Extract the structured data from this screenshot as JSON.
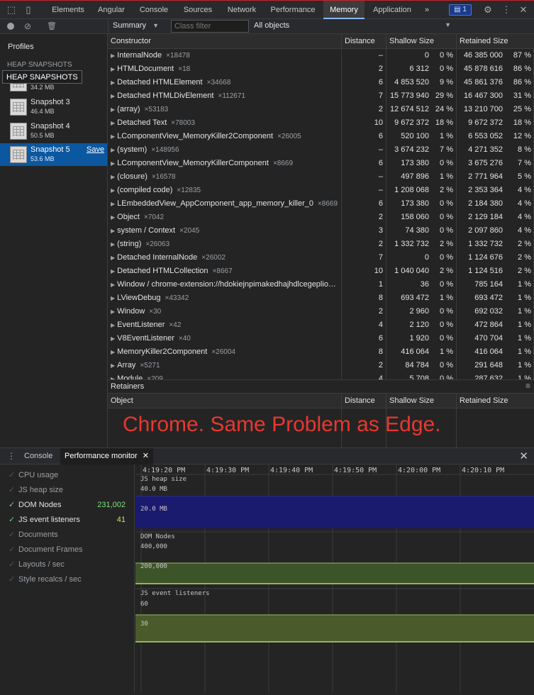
{
  "tabs": [
    "Elements",
    "Angular",
    "Console",
    "Sources",
    "Network",
    "Performance",
    "Memory",
    "Application"
  ],
  "tab_more": "»",
  "issues_badge": "1",
  "toolbar": {
    "summary": "Summary",
    "class_filter_placeholder": "Class filter",
    "objects": "All objects"
  },
  "sidebar": {
    "profiles": "Profiles",
    "heap_snapshots": "HEAP SNAPSHOTS",
    "tooltip": "HEAP SNAPSHOTS",
    "snap2_size": "34.2 MB",
    "snapshots": [
      {
        "name": "Snapshot 3",
        "size": "46.4 MB"
      },
      {
        "name": "Snapshot 4",
        "size": "50.5 MB"
      },
      {
        "name": "Snapshot 5",
        "size": "53.6 MB",
        "action": "Save"
      }
    ]
  },
  "grid": {
    "headers": {
      "constructor": "Constructor",
      "distance": "Distance",
      "shallow": "Shallow Size",
      "retained": "Retained Size"
    },
    "rows": [
      {
        "name": "InternalNode",
        "count": "×18478",
        "dist": "–",
        "shallow": "0",
        "sp": "0 %",
        "retained": "46 385 000",
        "rp": "87 %"
      },
      {
        "name": "HTMLDocument",
        "count": "×18",
        "dist": "2",
        "shallow": "6 312",
        "sp": "0 %",
        "retained": "45 878 616",
        "rp": "86 %"
      },
      {
        "name": "Detached HTMLElement",
        "count": "×34668",
        "dist": "6",
        "shallow": "4 853 520",
        "sp": "9 %",
        "retained": "45 861 376",
        "rp": "86 %"
      },
      {
        "name": "Detached HTMLDivElement",
        "count": "×112671",
        "dist": "7",
        "shallow": "15 773 940",
        "sp": "29 %",
        "retained": "16 467 300",
        "rp": "31 %"
      },
      {
        "name": "(array)",
        "count": "×53183",
        "dist": "2",
        "shallow": "12 674 512",
        "sp": "24 %",
        "retained": "13 210 700",
        "rp": "25 %"
      },
      {
        "name": "Detached Text",
        "count": "×78003",
        "dist": "10",
        "shallow": "9 672 372",
        "sp": "18 %",
        "retained": "9 672 372",
        "rp": "18 %"
      },
      {
        "name": "LComponentView_MemoryKiller2Component",
        "count": "×26005",
        "dist": "6",
        "shallow": "520 100",
        "sp": "1 %",
        "retained": "6 553 052",
        "rp": "12 %"
      },
      {
        "name": "(system)",
        "count": "×148956",
        "dist": "–",
        "shallow": "3 674 232",
        "sp": "7 %",
        "retained": "4 271 352",
        "rp": "8 %"
      },
      {
        "name": "LComponentView_MemoryKillerComponent",
        "count": "×8669",
        "dist": "6",
        "shallow": "173 380",
        "sp": "0 %",
        "retained": "3 675 276",
        "rp": "7 %"
      },
      {
        "name": "(closure)",
        "count": "×16578",
        "dist": "–",
        "shallow": "497 896",
        "sp": "1 %",
        "retained": "2 771 964",
        "rp": "5 %"
      },
      {
        "name": "(compiled code)",
        "count": "×12835",
        "dist": "–",
        "shallow": "1 208 068",
        "sp": "2 %",
        "retained": "2 353 364",
        "rp": "4 %"
      },
      {
        "name": "LEmbeddedView_AppComponent_app_memory_killer_0",
        "count": "×8669",
        "dist": "6",
        "shallow": "173 380",
        "sp": "0 %",
        "retained": "2 184 380",
        "rp": "4 %"
      },
      {
        "name": "Object",
        "count": "×7042",
        "dist": "2",
        "shallow": "158 060",
        "sp": "0 %",
        "retained": "2 129 184",
        "rp": "4 %"
      },
      {
        "name": "system / Context",
        "count": "×2045",
        "dist": "3",
        "shallow": "74 380",
        "sp": "0 %",
        "retained": "2 097 860",
        "rp": "4 %"
      },
      {
        "name": "(string)",
        "count": "×26063",
        "dist": "2",
        "shallow": "1 332 732",
        "sp": "2 %",
        "retained": "1 332 732",
        "rp": "2 %"
      },
      {
        "name": "Detached InternalNode",
        "count": "×26002",
        "dist": "7",
        "shallow": "0",
        "sp": "0 %",
        "retained": "1 124 676",
        "rp": "2 %"
      },
      {
        "name": "Detached HTMLCollection",
        "count": "×8667",
        "dist": "10",
        "shallow": "1 040 040",
        "sp": "2 %",
        "retained": "1 124 516",
        "rp": "2 %"
      },
      {
        "name": "Window / chrome-extension://hdokiejnpimakedhajhdlcegeplio…",
        "count": "",
        "dist": "1",
        "shallow": "36",
        "sp": "0 %",
        "retained": "785 164",
        "rp": "1 %"
      },
      {
        "name": "LViewDebug",
        "count": "×43342",
        "dist": "8",
        "shallow": "693 472",
        "sp": "1 %",
        "retained": "693 472",
        "rp": "1 %"
      },
      {
        "name": "Window",
        "count": "×30",
        "dist": "2",
        "shallow": "2 960",
        "sp": "0 %",
        "retained": "692 032",
        "rp": "1 %"
      },
      {
        "name": "EventListener",
        "count": "×42",
        "dist": "4",
        "shallow": "2 120",
        "sp": "0 %",
        "retained": "472 864",
        "rp": "1 %"
      },
      {
        "name": "V8EventListener",
        "count": "×40",
        "dist": "6",
        "shallow": "1 920",
        "sp": "0 %",
        "retained": "470 704",
        "rp": "1 %"
      },
      {
        "name": "MemoryKiller2Component",
        "count": "×26004",
        "dist": "8",
        "shallow": "416 064",
        "sp": "1 %",
        "retained": "416 064",
        "rp": "1 %"
      },
      {
        "name": "Array",
        "count": "×5271",
        "dist": "2",
        "shallow": "84 784",
        "sp": "0 %",
        "retained": "291 648",
        "rp": "1 %"
      },
      {
        "name": "Module",
        "count": "×209",
        "dist": "4",
        "shallow": "5 708",
        "sp": "0 %",
        "retained": "287 632",
        "rp": "1 %"
      }
    ]
  },
  "retainers": {
    "title": "Retainers",
    "object": "Object",
    "distance": "Distance",
    "shallow": "Shallow Size",
    "retained": "Retained Size"
  },
  "overlay_text": "Chrome. Same Problem as Edge.",
  "overlay_color": "#e8382f",
  "drawer": {
    "console": "Console",
    "perf": "Performance monitor"
  },
  "metrics": [
    {
      "label": "CPU usage",
      "value": "",
      "checked": false
    },
    {
      "label": "JS heap size",
      "value": "",
      "checked": false
    },
    {
      "label": "DOM Nodes",
      "value": "231,002",
      "checked": true
    },
    {
      "label": "JS event listeners",
      "value": "41",
      "checked": true
    },
    {
      "label": "Documents",
      "value": "",
      "checked": false
    },
    {
      "label": "Document Frames",
      "value": "",
      "checked": false
    },
    {
      "label": "Layouts / sec",
      "value": "",
      "checked": false
    },
    {
      "label": "Style recalcs / sec",
      "value": "",
      "checked": false
    }
  ],
  "chart_data": {
    "type": "area",
    "time_ticks": [
      "4:19:20 PM",
      "4:19:30 PM",
      "4:19:40 PM",
      "4:19:50 PM",
      "4:20:00 PM",
      "4:20:10 PM"
    ],
    "panels": [
      {
        "name": "JS heap size",
        "ticks": [
          "40.0 MB",
          "20.0 MB"
        ],
        "color": "#1a1a6e"
      },
      {
        "name": "DOM Nodes",
        "ticks": [
          "400,000",
          "200,000"
        ],
        "color": "#3d5429"
      },
      {
        "name": "JS event listeners",
        "ticks": [
          "60",
          "30"
        ],
        "color": "#4a5a2a"
      }
    ]
  }
}
